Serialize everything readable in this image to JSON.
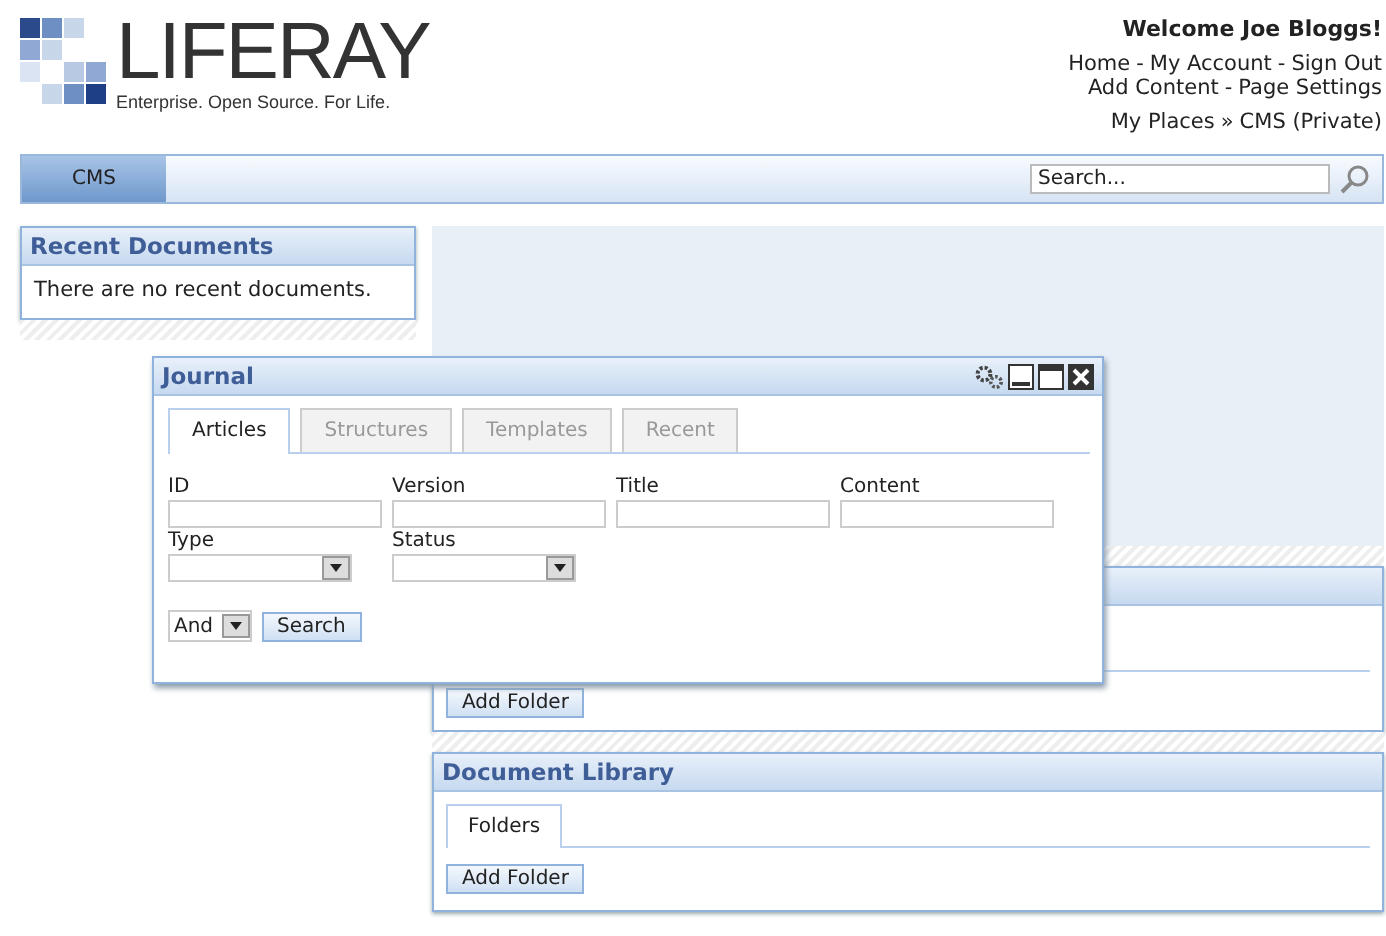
{
  "logo": {
    "name": "LIFERAY",
    "tagline": "Enterprise. Open Source. For Life."
  },
  "user": {
    "welcome": "Welcome Joe Bloggs!",
    "link_rows": [
      {
        "separator": "-",
        "links": [
          "Home",
          "My Account",
          "Sign Out"
        ]
      },
      {
        "separator": "-",
        "links": [
          "Add Content",
          "Page Settings"
        ]
      },
      {
        "separator": "»",
        "links": [
          "My Places",
          "CMS (Private)"
        ]
      }
    ]
  },
  "nav": {
    "tabs": [
      {
        "label": "CMS",
        "selected": true
      }
    ],
    "search": {
      "placeholder": "Search..."
    }
  },
  "recent_documents": {
    "title": "Recent Documents",
    "message": "There are no recent documents."
  },
  "covered_portlet": {
    "button": "Add Folder"
  },
  "document_library": {
    "title": "Document Library",
    "tabs": [
      {
        "label": "Folders",
        "selected": true
      }
    ],
    "button": "Add Folder"
  },
  "journal": {
    "title": "Journal",
    "tabs": [
      {
        "label": "Articles",
        "selected": true
      },
      {
        "label": "Structures",
        "selected": false
      },
      {
        "label": "Templates",
        "selected": false
      },
      {
        "label": "Recent",
        "selected": false
      }
    ],
    "fields": [
      {
        "label": "ID",
        "kind": "text"
      },
      {
        "label": "Version",
        "kind": "text"
      },
      {
        "label": "Title",
        "kind": "text"
      },
      {
        "label": "Content",
        "kind": "text"
      },
      {
        "label": "Type",
        "kind": "select"
      },
      {
        "label": "Status",
        "kind": "select"
      }
    ],
    "operator": "And",
    "search_button": "Search"
  }
}
